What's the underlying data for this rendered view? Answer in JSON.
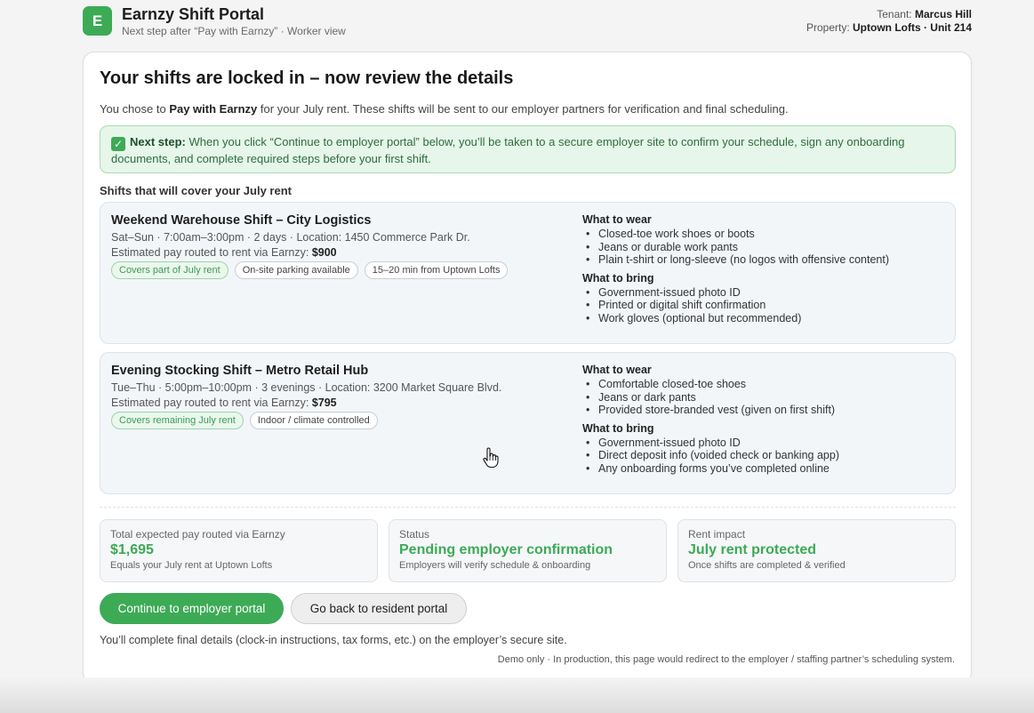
{
  "header": {
    "logo_letter": "E",
    "app_title": "Earnzy Shift Portal",
    "subtitle": "Next step after “Pay with Earnzy” · Worker view",
    "tenant_label": "Tenant:",
    "tenant_name": "Marcus Hill",
    "property_label": "Property:",
    "property_name": "Uptown Lofts · Unit 214"
  },
  "main": {
    "title": "Your shifts are locked in – now review the details",
    "intro_pre": "You chose to ",
    "intro_bold": "Pay with Earnzy",
    "intro_post": " for your July rent. These shifts will be sent to our employer partners for verification and final scheduling.",
    "notice_bold": "Next step:",
    "notice_text": " When you click “Continue to employer portal” below, you’ll be taken to a secure employer site to confirm your schedule, sign any onboarding documents, and complete required steps before your first shift.",
    "section_label": "Shifts that will cover your July rent"
  },
  "shifts": [
    {
      "name": "Weekend Warehouse Shift – City Logistics",
      "meta": "Sat–Sun · 7:00am–3:00pm · 2 days · Location: 1450 Commerce Park Dr.",
      "pay_label": "Estimated pay routed to rent via Earnzy: ",
      "pay_value": "$900",
      "tags": [
        "Covers part of July rent",
        "On-site parking available",
        "15–20 min from Uptown Lofts"
      ],
      "wear_title": "What to wear",
      "wear": [
        "Closed-toe work shoes or boots",
        "Jeans or durable work pants",
        "Plain t-shirt or long-sleeve (no logos with offensive content)"
      ],
      "bring_title": "What to bring",
      "bring": [
        "Government-issued photo ID",
        "Printed or digital shift confirmation",
        "Work gloves (optional but recommended)"
      ]
    },
    {
      "name": "Evening Stocking Shift – Metro Retail Hub",
      "meta": "Tue–Thu · 5:00pm–10:00pm · 3 evenings · Location: 3200 Market Square Blvd.",
      "pay_label": "Estimated pay routed to rent via Earnzy: ",
      "pay_value": "$795",
      "tags": [
        "Covers remaining July rent",
        "Indoor / climate controlled"
      ],
      "wear_title": "What to wear",
      "wear": [
        "Comfortable closed-toe shoes",
        "Jeans or dark pants",
        "Provided store-branded vest (given on first shift)"
      ],
      "bring_title": "What to bring",
      "bring": [
        "Government-issued photo ID",
        "Direct deposit info (voided check or banking app)",
        "Any onboarding forms you’ve completed online"
      ]
    }
  ],
  "stats": [
    {
      "label": "Total expected pay routed via Earnzy",
      "value": "$1,695",
      "sub": "Equals your July rent at Uptown Lofts"
    },
    {
      "label": "Status",
      "value": "Pending employer confirmation",
      "sub": "Employers will verify schedule & onboarding"
    },
    {
      "label": "Rent impact",
      "value": "July rent protected",
      "sub": "Once shifts are completed & verified"
    }
  ],
  "actions": {
    "primary": "Continue to employer portal",
    "secondary": "Go back to resident portal"
  },
  "footer": {
    "final_note": "You’ll complete final details (clock-in instructions, tax forms, etc.) on the employer’s secure site.",
    "demo_note": "Demo only · In production, this page would redirect to the employer / staffing partner’s scheduling system."
  },
  "colors": {
    "accent": "#3daa56",
    "notice_bg": "#e6f6ea",
    "card_bg": "#f3f6f9"
  }
}
